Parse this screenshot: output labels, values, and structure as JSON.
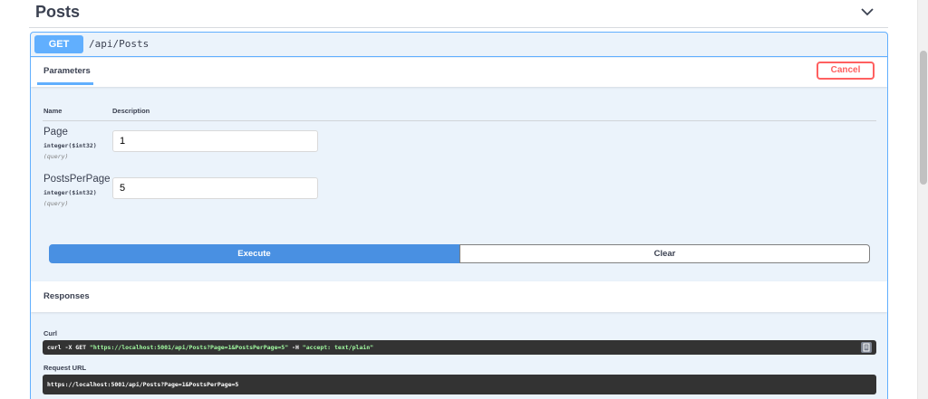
{
  "section": {
    "title": "Posts"
  },
  "operation": {
    "method": "GET",
    "path": "/api/Posts"
  },
  "parameters": {
    "tab_label": "Parameters",
    "cancel_label": "Cancel",
    "col_name": "Name",
    "col_description": "Description",
    "items": [
      {
        "name": "Page",
        "type": "integer($int32)",
        "in": "(query)",
        "value": "1"
      },
      {
        "name": "PostsPerPage",
        "type": "integer($int32)",
        "in": "(query)",
        "value": "5"
      }
    ]
  },
  "actions": {
    "execute_label": "Execute",
    "clear_label": "Clear"
  },
  "responses": {
    "title": "Responses",
    "curl_label": "Curl",
    "curl_cmd_prefix": "curl -X GET ",
    "curl_url": "\"https://localhost:5001/api/Posts?Page=1&PostsPerPage=5\"",
    "curl_flag": " -H ",
    "curl_header": " \"accept: text/plain\"",
    "request_url_label": "Request URL",
    "request_url": "https://localhost:5001/api/Posts?Page=1&PostsPerPage=5"
  },
  "colors": {
    "get_blue": "#61affe",
    "cancel_red": "#ff6060",
    "execute_blue": "#4990e2",
    "code_bg": "#333333",
    "code_string": "#a2fca2"
  }
}
